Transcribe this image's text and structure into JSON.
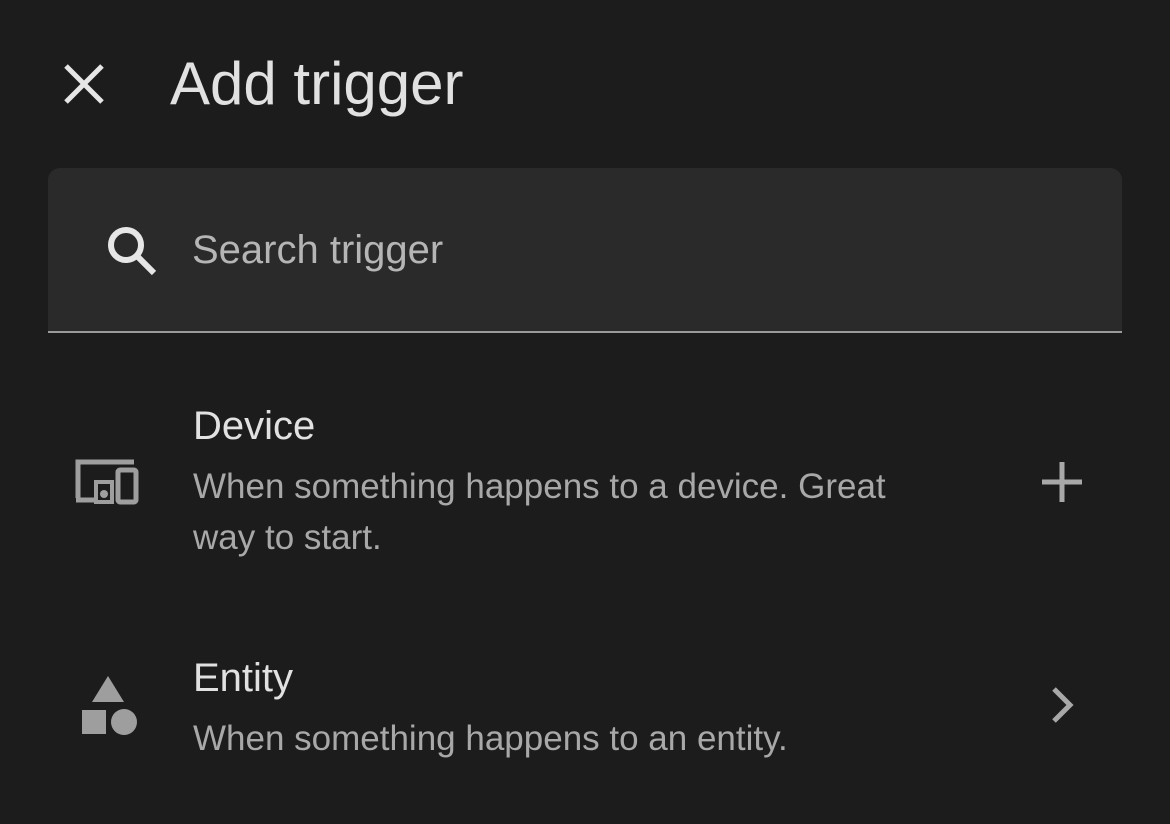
{
  "header": {
    "title": "Add trigger",
    "close_icon": "close-icon"
  },
  "search": {
    "icon": "search-icon",
    "placeholder": "Search trigger",
    "value": ""
  },
  "items": [
    {
      "icon": "devices-icon",
      "title": "Device",
      "description": "When something happens to a device. Great way to start.",
      "action_icon": "plus-icon"
    },
    {
      "icon": "shapes-icon",
      "title": "Entity",
      "description": "When something happens to an entity.",
      "action_icon": "chevron-right-icon"
    }
  ],
  "colors": {
    "background": "#1c1c1c",
    "surface": "#2a2a2a",
    "text_primary": "#e1e1e1",
    "text_secondary": "#a8a8a8",
    "icon": "#9e9e9e"
  }
}
